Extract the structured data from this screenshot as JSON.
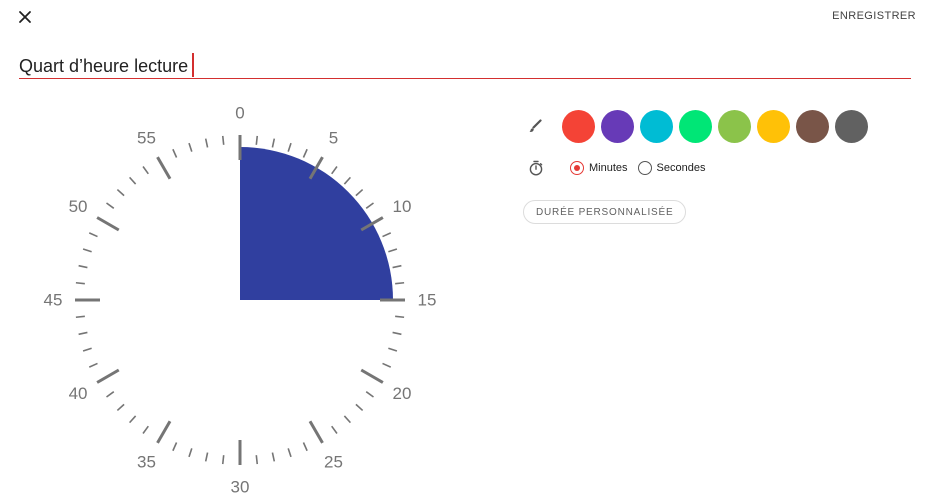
{
  "toolbar": {
    "close_icon": "close-icon",
    "save_label": "ENREGISTRER"
  },
  "title_input": {
    "value": "Quart d’heure lecture"
  },
  "timer": {
    "selected_minutes": 15,
    "max_minutes": 60,
    "fill_color": "#303f9f",
    "tick_color": "#757575",
    "labels": [
      "0",
      "5",
      "10",
      "15",
      "20",
      "25",
      "30",
      "35",
      "40",
      "45",
      "50",
      "55"
    ]
  },
  "colors": {
    "icon": "brush-icon",
    "swatches": [
      {
        "name": "red",
        "hex": "#f44336"
      },
      {
        "name": "purple",
        "hex": "#673ab7"
      },
      {
        "name": "cyan",
        "hex": "#00bcd4"
      },
      {
        "name": "green",
        "hex": "#00e676"
      },
      {
        "name": "light-green",
        "hex": "#8bc34a"
      },
      {
        "name": "amber",
        "hex": "#ffc107"
      },
      {
        "name": "brown",
        "hex": "#795548"
      },
      {
        "name": "grey",
        "hex": "#616161"
      }
    ]
  },
  "units": {
    "icon": "timer-icon",
    "options": [
      {
        "label": "Minutes",
        "checked": true
      },
      {
        "label": "Secondes",
        "checked": false
      }
    ]
  },
  "custom_duration": {
    "label": "DURÉE PERSONNALISÉE"
  }
}
